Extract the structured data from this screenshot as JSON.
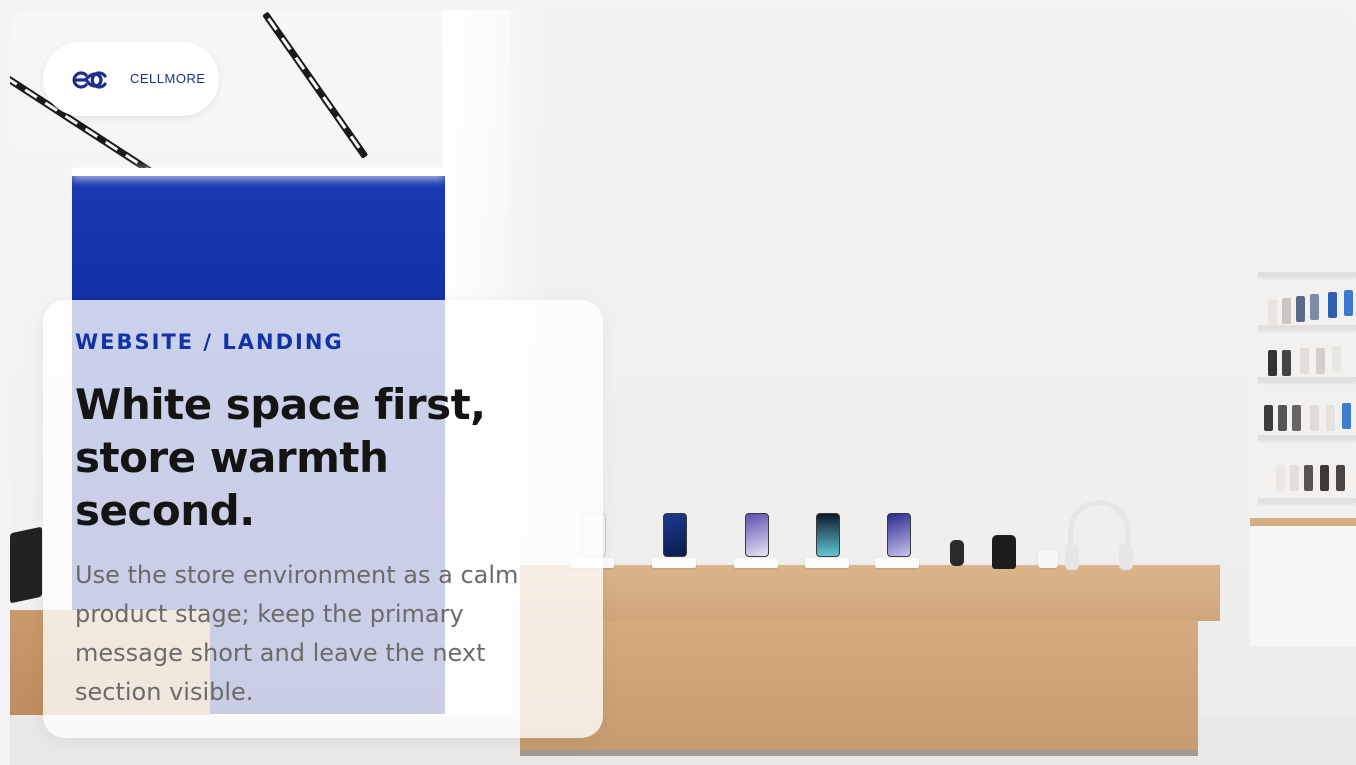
{
  "brand": {
    "logo_text": "CELLMORE",
    "logo_icon": "ec-monogram-icon",
    "accent_color": "#1432a8"
  },
  "hero": {
    "eyebrow": "WEBSITE / LANDING",
    "headline": "White space first, store warmth second.",
    "body": "Use the store environment as a calm product stage; keep the primary message short and leave the next section visible."
  }
}
